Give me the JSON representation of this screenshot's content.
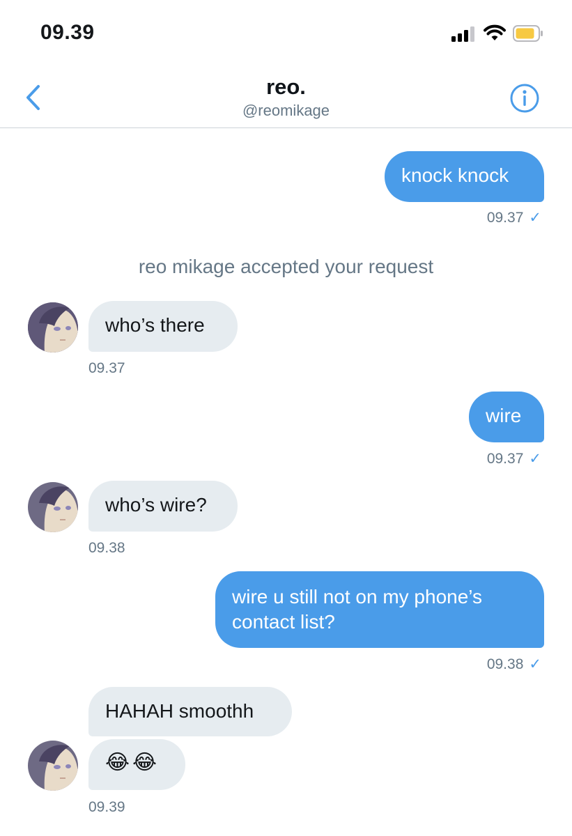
{
  "status": {
    "time": "09.39"
  },
  "header": {
    "title": "reo.",
    "handle": "@reomikage"
  },
  "messages": {
    "m1": {
      "text": "knock knock",
      "time": "09.37"
    },
    "system": {
      "text": "reo mikage accepted your request"
    },
    "m2": {
      "text": "who’s there",
      "time": "09.37"
    },
    "m3": {
      "text": "wire",
      "time": "09.37"
    },
    "m4": {
      "text": "who’s wire?",
      "time": "09.38"
    },
    "m5": {
      "line1": "wire u still not on my phone’s",
      "line2": "contact list?",
      "time": "09.38"
    },
    "m6": {
      "text": "HAHAH smoothh"
    },
    "m7": {
      "emoji": "😂😂",
      "time": "09.39"
    }
  },
  "icons": {
    "back": "chevron-left-icon",
    "info": "info-circle-icon",
    "read": "checkmark-icon",
    "signal": "cellular-signal-icon",
    "wifi": "wifi-icon",
    "battery": "battery-icon"
  },
  "colors": {
    "accent": "#4a9ce9",
    "incoming_bubble": "#e6ecf0",
    "battery_fill": "#f7c942"
  }
}
